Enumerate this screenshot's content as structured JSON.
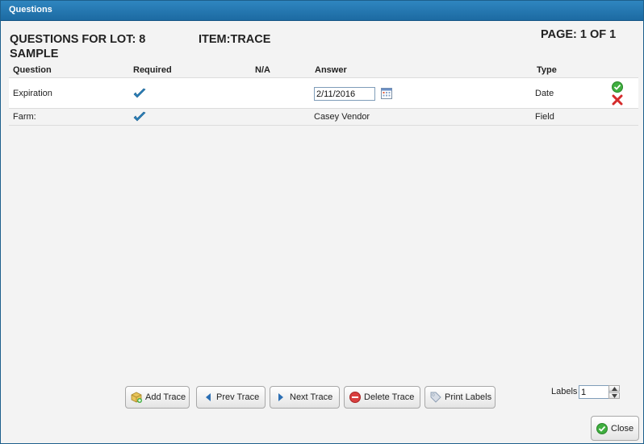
{
  "window": {
    "title": "Questions"
  },
  "header": {
    "lot_title": "QUESTIONS FOR LOT: 8",
    "item_title": "ITEM:TRACE",
    "sample_title": "SAMPLE",
    "page_indicator": "PAGE: 1 OF 1"
  },
  "grid": {
    "columns": [
      "Question",
      "Required",
      "N/A",
      "Answer",
      "Type"
    ],
    "rows": [
      {
        "question": "Expiration",
        "required": true,
        "answer": "2/11/2016",
        "type": "Date",
        "editing": true
      },
      {
        "question": "Farm:",
        "required": true,
        "answer": "Casey Vendor",
        "type": "Field",
        "editing": false
      }
    ]
  },
  "buttons": {
    "add_trace": "Add Trace",
    "prev_trace": "Prev Trace",
    "next_trace": "Next Trace",
    "delete_trace": "Delete Trace",
    "print_labels": "Print Labels",
    "close": "Close"
  },
  "labels": {
    "label": "Labels",
    "value": "1"
  },
  "icons": {
    "check": "checkmark-icon",
    "calendar": "calendar-icon",
    "save": "save-row-icon",
    "cancel": "cancel-row-icon"
  },
  "colors": {
    "titlebar": "#1c6aa2",
    "check": "#2a7fb8",
    "save": "#3fae3f",
    "cancel": "#d52b2b"
  }
}
